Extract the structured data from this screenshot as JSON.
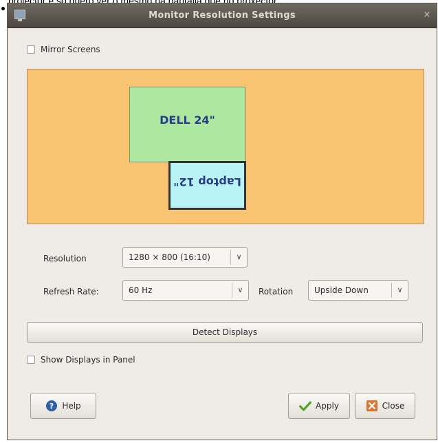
{
  "page_caption": "projector e so quero ver o mesmo na pantalla que no proxector",
  "window": {
    "title": "Monitor Resolution Settings",
    "close_symbol": "×"
  },
  "mirror_screens": {
    "label": "Mirror Screens",
    "checked": false
  },
  "displays": [
    {
      "label": "DELL 24\"",
      "color": "#aee7a0",
      "selected": false
    },
    {
      "label": "Laptop 12\"",
      "color": "#b8f3f6",
      "selected": true,
      "rotation": "Upside Down"
    }
  ],
  "arrangement_bg": "#fac573",
  "resolution": {
    "label": "Resolution",
    "value": "1280 × 800 (16:10)"
  },
  "refresh_rate": {
    "label": "Refresh Rate:",
    "value": "60 Hz"
  },
  "rotation": {
    "label": "Rotation",
    "value": "Upside Down"
  },
  "buttons": {
    "detect": "Detect Displays",
    "help": "Help",
    "apply": "Apply",
    "close": "Close"
  },
  "show_in_panel": {
    "label": "Show Displays in Panel",
    "checked": false
  },
  "colors": {
    "help_icon": "#2f5fa8",
    "apply_icon": "#5aa02c",
    "close_icon": "#e0702a"
  }
}
